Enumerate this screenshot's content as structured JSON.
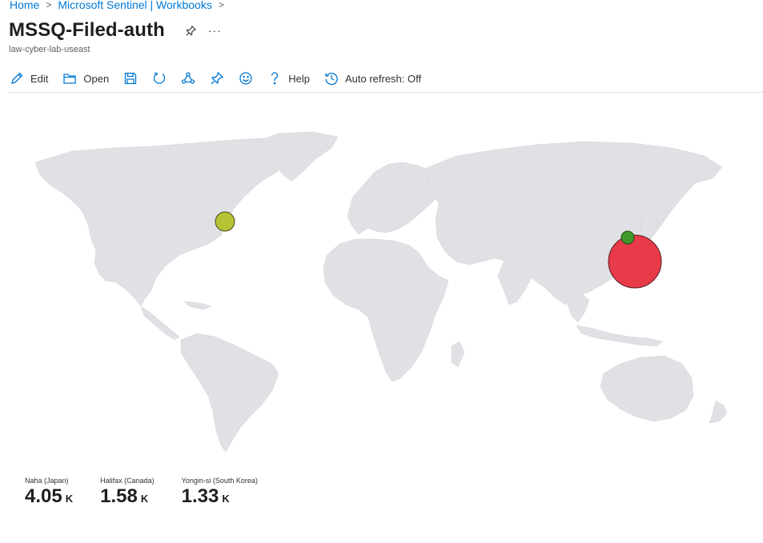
{
  "breadcrumb": {
    "home": "Home",
    "sentinel": "Microsoft Sentinel | Workbooks",
    "sep": ">"
  },
  "header": {
    "title": "MSSQ-Filed-auth",
    "subtitle": "law-cyber-lab-useast",
    "more": "···"
  },
  "toolbar": {
    "edit": "Edit",
    "open": "Open",
    "help": "Help",
    "auto_refresh": "Auto refresh: Off"
  },
  "map": {
    "points": [
      {
        "location": "Halifax (Canada)",
        "color": "#b5c234",
        "value": 1580
      },
      {
        "location": "Yongin-si (South Korea)",
        "color": "#3e9a2b",
        "value": 1330
      },
      {
        "location": "Naha (Japan)",
        "color": "#e83b4a",
        "value": 4050
      }
    ]
  },
  "tiles": [
    {
      "label": "Naha (Japan)",
      "value": "4.05",
      "unit": "K"
    },
    {
      "label": "Halifax (Canada)",
      "value": "1.58",
      "unit": "K"
    },
    {
      "label": "Yongin-si (South Korea)",
      "value": "1.33",
      "unit": "K"
    }
  ],
  "colors": {
    "accent": "#0078d4",
    "land": "#dfe1e5"
  }
}
